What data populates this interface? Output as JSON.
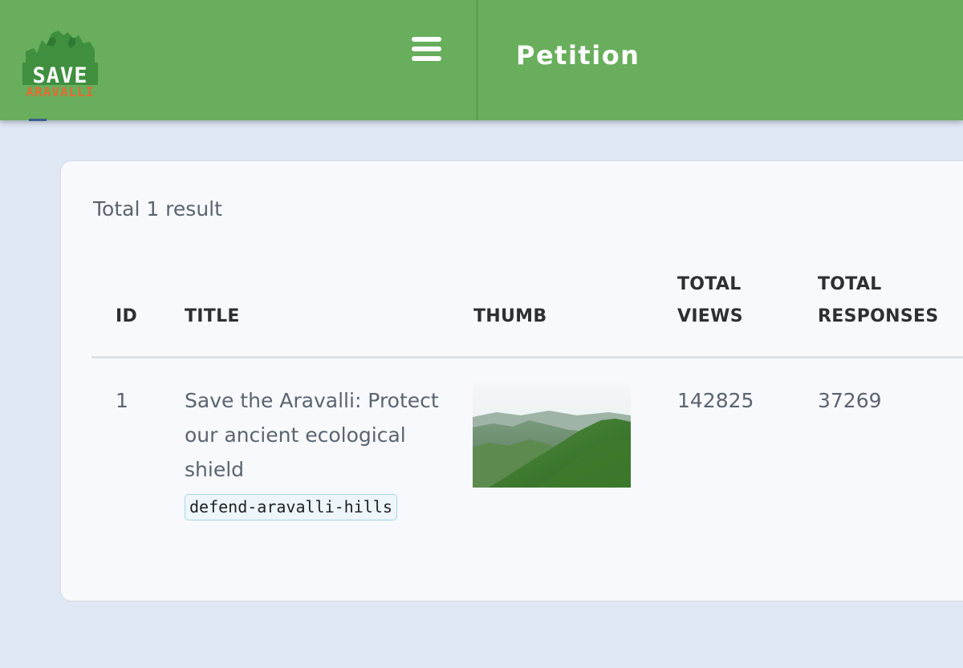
{
  "header": {
    "logo_word": "SAVE",
    "logo_sub": "ARAVALLI",
    "title": "Petition"
  },
  "colors": {
    "header_bg": "#68ae5c",
    "page_bg": "#dfe6f4",
    "card_bg": "#f7f9fc",
    "logo_accent": "#e36b32"
  },
  "results": {
    "summary": "Total 1 result"
  },
  "table": {
    "columns": {
      "id": "ID",
      "title": "TITLE",
      "thumb": "THUMB",
      "views_line1": "TOTAL",
      "views_line2": "VIEWS",
      "responses_line1": "TOTAL",
      "responses_line2": "RESPONSES"
    },
    "rows": [
      {
        "id": "1",
        "title_line1": "Save the Aravalli: Protect",
        "title_line2": "our ancient ecological",
        "title_line3": "shield",
        "slug": "defend-aravalli-hills",
        "thumb": "green-hills-photo",
        "total_views": "142825",
        "total_responses": "37269"
      }
    ]
  },
  "icons": {
    "menu": "hamburger-menu-icon",
    "logo": "save-aravalli-logo"
  }
}
